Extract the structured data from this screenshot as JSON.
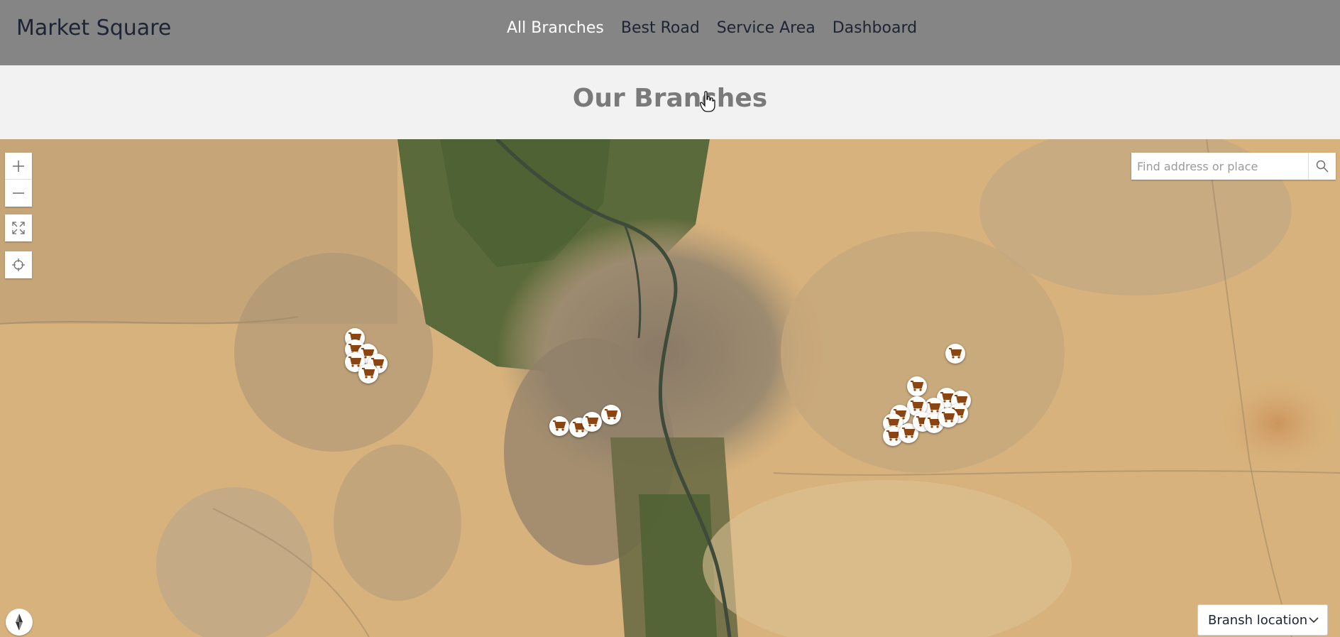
{
  "header": {
    "brand": "Market Square",
    "nav": [
      {
        "label": "All Branches",
        "active": true
      },
      {
        "label": "Best Road",
        "active": false
      },
      {
        "label": "Service Area",
        "active": false
      },
      {
        "label": "Dashboard",
        "active": false
      }
    ]
  },
  "page": {
    "title": "Our Branches"
  },
  "map": {
    "search": {
      "placeholder": "Find address or place",
      "value": ""
    },
    "controls": {
      "zoom_in_icon": "plus-icon",
      "zoom_out_icon": "minus-icon",
      "fullscreen_icon": "expand-icon",
      "locate_icon": "crosshair-icon",
      "compass_icon": "compass-icon"
    },
    "layer_select": {
      "selected": "Bransh location"
    },
    "marker_icon": "shopping-cart-icon",
    "colors": {
      "marker_cart": "#8b4513",
      "navbar": "#858585",
      "nav_active": "#ffffff"
    }
  }
}
